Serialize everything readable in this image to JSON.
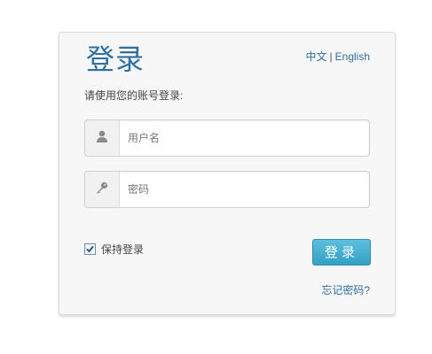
{
  "login": {
    "title": "登录",
    "subtitle": "请使用您的账号登录:",
    "lang": {
      "chinese": "中文",
      "separator": "|",
      "english": "English"
    },
    "username": {
      "placeholder": "用户名",
      "value": "",
      "icon": "user-icon"
    },
    "password": {
      "placeholder": "密码",
      "value": "",
      "icon": "key-icon"
    },
    "remember": {
      "label": "保持登录",
      "checked": true
    },
    "submit_label": "登录",
    "forgot_label": "忘记密码?"
  },
  "colors": {
    "title": "#2f6f9f",
    "link": "#2d6ea0",
    "button_top": "#5cc0de",
    "button_bottom": "#339fc6",
    "card_bg": "#f7f7f7"
  }
}
